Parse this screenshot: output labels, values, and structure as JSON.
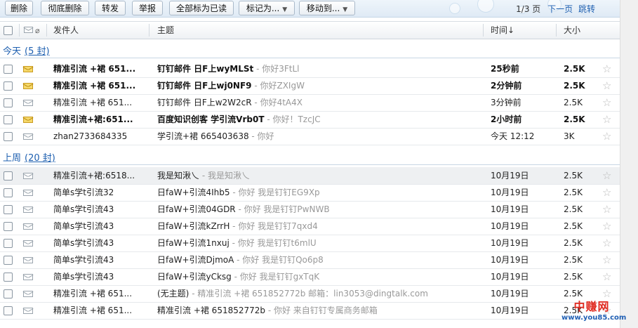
{
  "toolbar": {
    "buttons": [
      "删除",
      "彻底删除",
      "转发",
      "举报",
      "全部标为已读",
      "标记为...",
      "移动到..."
    ],
    "pager_count": "1/3 页",
    "next_page": "下一页",
    "jump": "跳转"
  },
  "columns": {
    "sender": "发件人",
    "subject": "主题",
    "time": "时间↓",
    "size": "大小"
  },
  "groups": [
    {
      "label": "今天",
      "count": "(5 封)",
      "rows": [
        {
          "from": "精准引流 +裙 651...",
          "subject": "钉钉邮件 日F上wyMLSt",
          "preview": " - 你好3FtLl",
          "time": "25秒前",
          "size": "2.5K",
          "unread": true
        },
        {
          "from": "精准引流 +裙 651...",
          "subject": "钉钉邮件 日F上wj0NF9",
          "preview": " - 你好ZXIgW",
          "time": "2分钟前",
          "size": "2.5K",
          "unread": true
        },
        {
          "from": "精准引流 +裙 651...",
          "subject": "钉钉邮件 日F上w2W2cR",
          "preview": " - 你好4tA4X",
          "time": "3分钟前",
          "size": "2.5K",
          "unread": false
        },
        {
          "from": "精准引流+裙:651...",
          "subject": "百度知识创客 学引流Vrb0T",
          "preview": " - 你好！TzcJC",
          "time": "2小时前",
          "size": "2.5K",
          "unread": true
        },
        {
          "from": "zhan2733684335",
          "subject": "学引流+裙 665403638",
          "preview": " - 你好",
          "time": "今天 12:12",
          "size": "3K",
          "unread": false
        }
      ]
    },
    {
      "label": "上周",
      "count": "(20 封)",
      "rows": [
        {
          "from": "精准引流+裙:6518...",
          "subject": "我是知湫乀",
          "preview": " - 我是知湫乀",
          "time": "10月19日",
          "size": "2.5K",
          "unread": false
        },
        {
          "from": "简单s学t引流32",
          "subject": "日faW+引流4Ihb5",
          "preview": " - 你好 我是钉钉EG9Xp",
          "time": "10月19日",
          "size": "2.5K",
          "unread": false
        },
        {
          "from": "简单s学t引流43",
          "subject": "日faW+引流04GDR",
          "preview": " - 你好 我是钉钉PwNWB",
          "time": "10月19日",
          "size": "2.5K",
          "unread": false
        },
        {
          "from": "简单s学t引流43",
          "subject": "日faW+引流kZrrH",
          "preview": " - 你好 我是钉钉7qxd4",
          "time": "10月19日",
          "size": "2.5K",
          "unread": false
        },
        {
          "from": "简单s学t引流43",
          "subject": "日faW+引流1nxuj",
          "preview": " - 你好 我是钉钉t6mlU",
          "time": "10月19日",
          "size": "2.5K",
          "unread": false
        },
        {
          "from": "简单s学t引流43",
          "subject": "日faW+引流DjmoA",
          "preview": " - 你好 我是钉钉Qo6p8",
          "time": "10月19日",
          "size": "2.5K",
          "unread": false
        },
        {
          "from": "简单s学t引流43",
          "subject": "日faW+引流yCksg",
          "preview": " - 你好 我是钉钉gxTqK",
          "time": "10月19日",
          "size": "2.5K",
          "unread": false
        },
        {
          "from": "精准引流 +裙 651...",
          "subject": "(无主题)",
          "preview": " - 精准引流 +裙 651852772b 邮箱：lin3053@dingtalk.com",
          "time": "10月19日",
          "size": "2.5K",
          "unread": false
        },
        {
          "from": "精准引流 +裙 651...",
          "subject": "精准引流 +裙 651852772b",
          "preview": " - 你好 来自钉钉专属商务邮箱",
          "time": "10月19日",
          "size": "2.5K",
          "unread": false
        }
      ]
    }
  ],
  "watermark": {
    "name": "中赚网",
    "url": "www.you85.com"
  },
  "colors": {
    "link": "#1d5fb0",
    "unread_envelope": "#f5d86a",
    "watermark_red": "#e02a20"
  }
}
